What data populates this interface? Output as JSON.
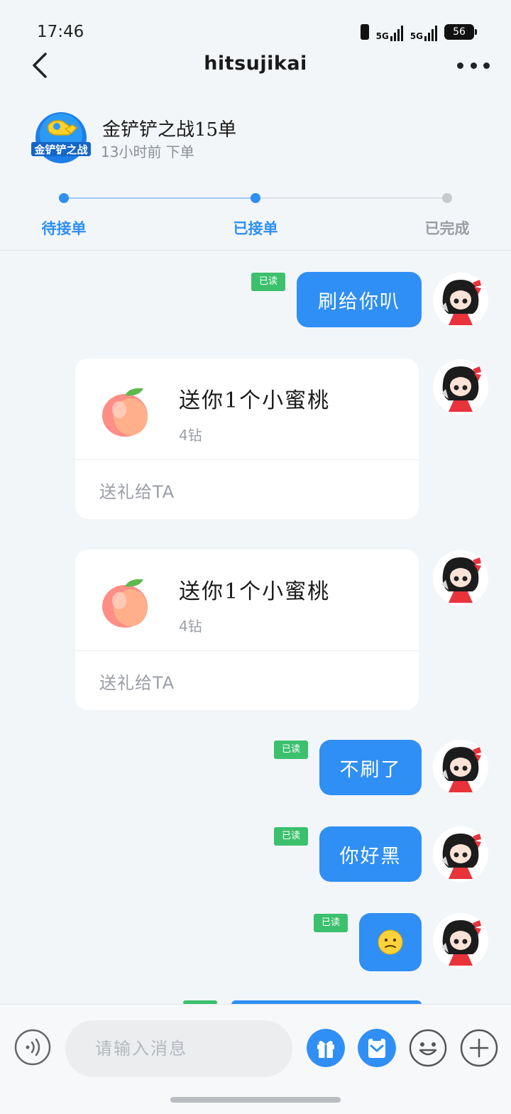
{
  "status_bar": {
    "time": "17:46",
    "signal1": "5G",
    "signal2": "5G",
    "battery": "56"
  },
  "header": {
    "title": "hitsujikai"
  },
  "order": {
    "logo_text": "金铲铲之战",
    "title": "金铲铲之战15单",
    "subtitle": "13小时前 下单"
  },
  "progress": {
    "steps": [
      {
        "label": "待接单",
        "state": "done"
      },
      {
        "label": "已接单",
        "state": "current"
      },
      {
        "label": "已完成",
        "state": "pending"
      }
    ],
    "active_color": "#2f8ff5",
    "inactive_color": "#c7cacd"
  },
  "messages": [
    {
      "type": "text",
      "text": "刷给你叭",
      "read": "已读"
    },
    {
      "type": "gift",
      "title": "送你1个小蜜桃",
      "price": "4钻",
      "action": "送礼给TA"
    },
    {
      "type": "gift",
      "title": "送你1个小蜜桃",
      "price": "4钻",
      "action": "送礼给TA"
    },
    {
      "type": "text",
      "text": "不刷了",
      "read": "已读"
    },
    {
      "type": "text",
      "text": "你好黑",
      "read": "已读"
    },
    {
      "type": "emoji",
      "text": "😕",
      "read": "已读"
    }
  ],
  "input": {
    "placeholder": "请输入消息",
    "value": ""
  },
  "icons": {
    "voice": "voice-icon",
    "gift": "gift-icon",
    "order": "order-icon",
    "emoji": "emoji-icon",
    "plus": "plus-icon",
    "accent": "#2f8ff5",
    "read_green": "#3cc06e"
  }
}
